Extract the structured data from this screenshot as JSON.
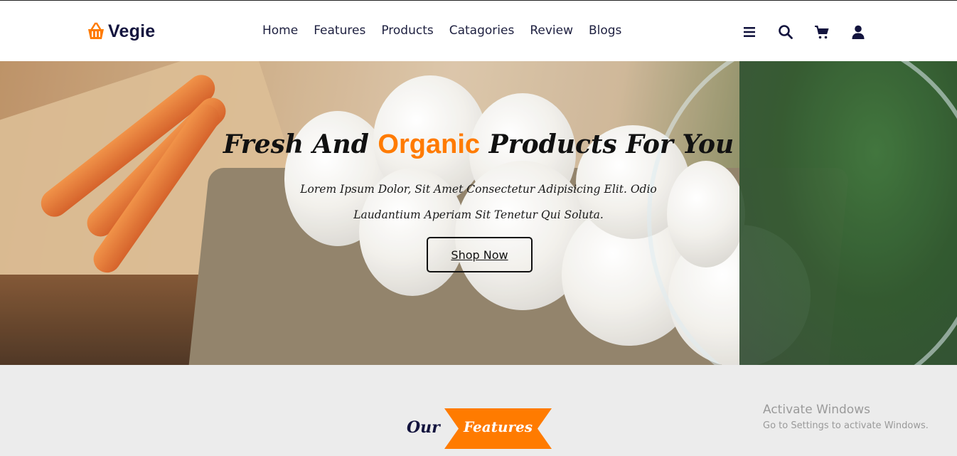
{
  "brand": {
    "name": "Vegie",
    "accent_color": "#ff7b00",
    "text_color": "#13143e"
  },
  "nav": {
    "items": [
      "Home",
      "Features",
      "Products",
      "Catagories",
      "Review",
      "Blogs"
    ]
  },
  "header_icons": [
    "menu-icon",
    "search-icon",
    "cart-icon",
    "user-icon"
  ],
  "hero": {
    "title_before": "Fresh And ",
    "title_accent": "Organic",
    "title_after": " Products For You",
    "text": "Lorem Ipsum Dolor, Sit Amet Consectetur Adipisicing Elit. Odio Laudantium Aperiam Sit Tenetur Qui Soluta.",
    "button": "Shop Now"
  },
  "features": {
    "prefix": "Our",
    "label": "Features"
  },
  "watermark": {
    "title": "Activate Windows",
    "subtitle": "Go to Settings to activate Windows."
  }
}
